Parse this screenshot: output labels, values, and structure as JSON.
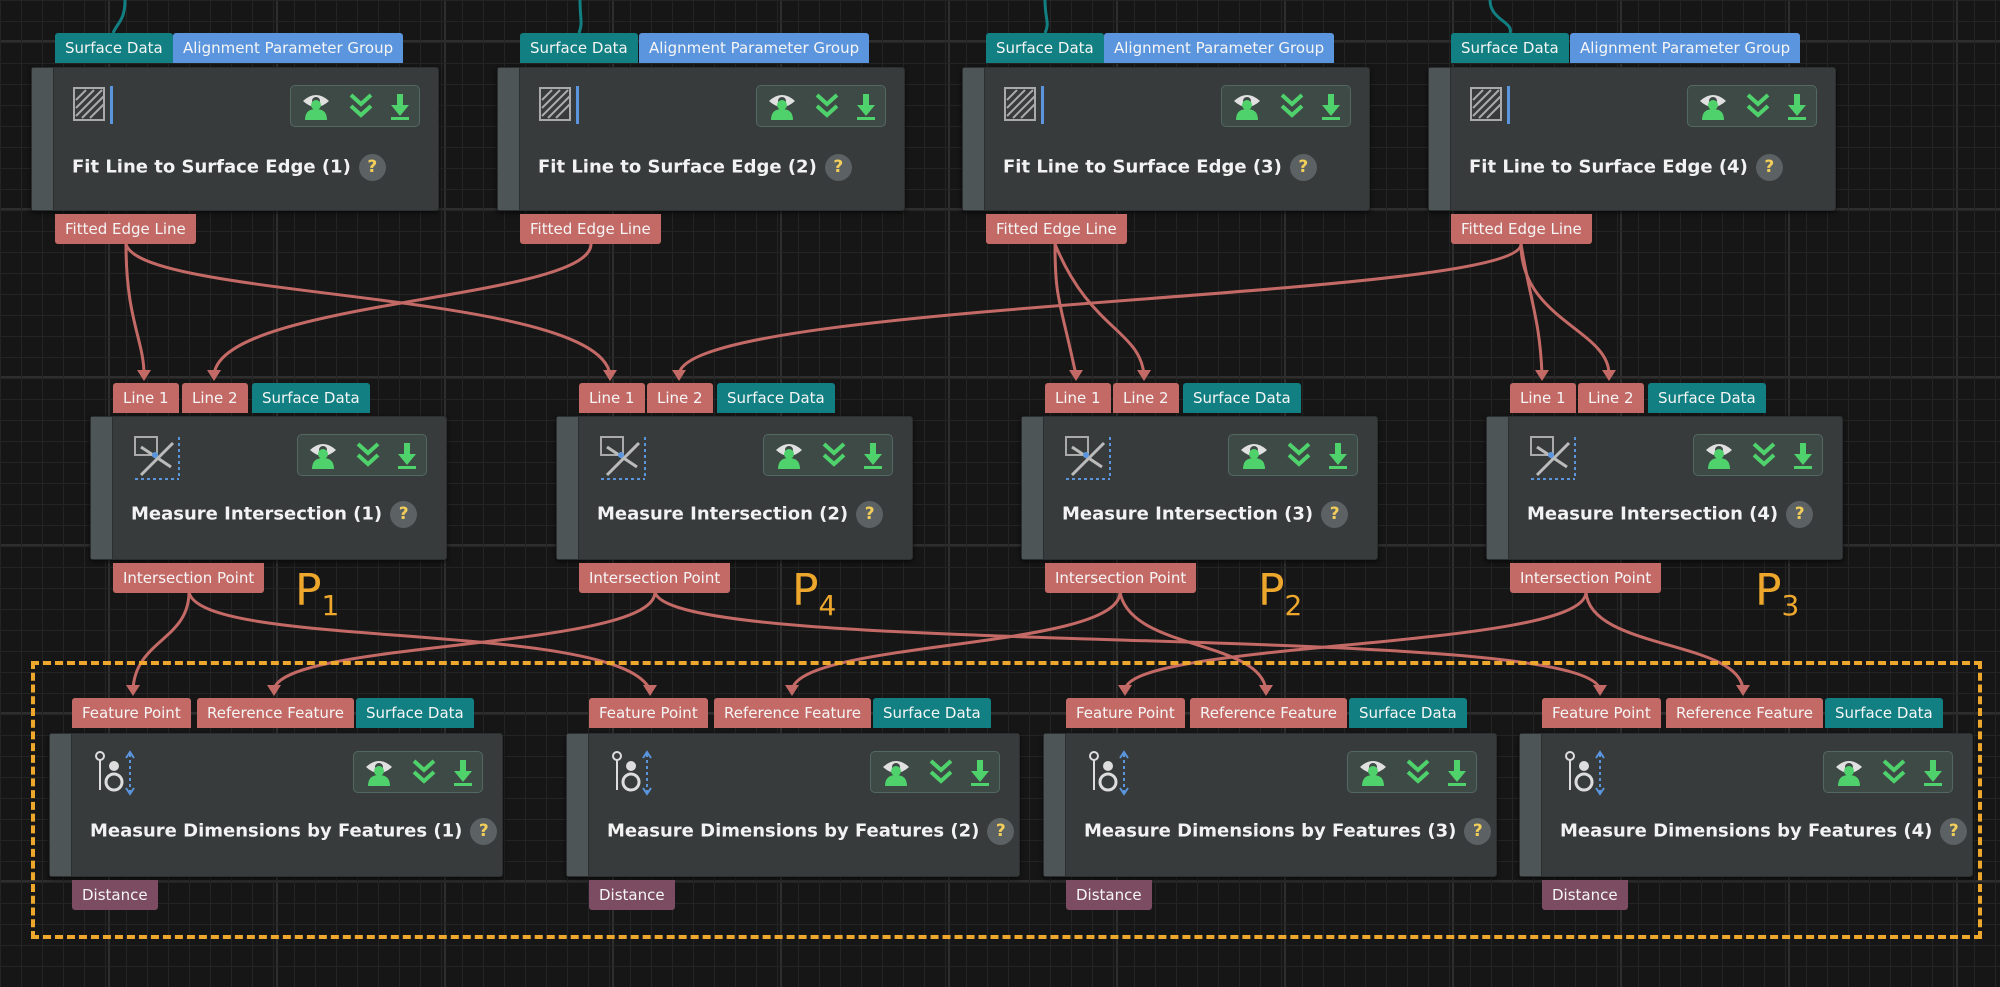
{
  "fit_nodes": [
    {
      "title": "Fit Line to Surface Edge (1)",
      "inputs": [
        "Surface Data",
        "Alignment Parameter Group"
      ],
      "output": "Fitted Edge Line"
    },
    {
      "title": "Fit Line to Surface Edge (2)",
      "inputs": [
        "Surface Data",
        "Alignment Parameter Group"
      ],
      "output": "Fitted Edge Line"
    },
    {
      "title": "Fit Line to Surface Edge (3)",
      "inputs": [
        "Surface Data",
        "Alignment Parameter Group"
      ],
      "output": "Fitted Edge Line"
    },
    {
      "title": "Fit Line to Surface Edge (4)",
      "inputs": [
        "Surface Data",
        "Alignment Parameter Group"
      ],
      "output": "Fitted Edge Line"
    }
  ],
  "intersect_nodes": [
    {
      "title": "Measure Intersection (1)",
      "inputs": [
        "Line 1",
        "Line 2",
        "Surface Data"
      ],
      "output": "Intersection Point"
    },
    {
      "title": "Measure Intersection (2)",
      "inputs": [
        "Line 1",
        "Line 2",
        "Surface Data"
      ],
      "output": "Intersection Point"
    },
    {
      "title": "Measure Intersection (3)",
      "inputs": [
        "Line 1",
        "Line 2",
        "Surface Data"
      ],
      "output": "Intersection Point"
    },
    {
      "title": "Measure Intersection (4)",
      "inputs": [
        "Line 1",
        "Line 2",
        "Surface Data"
      ],
      "output": "Intersection Point"
    }
  ],
  "dimension_nodes": [
    {
      "title": "Measure Dimensions by Features (1)",
      "inputs": [
        "Feature Point",
        "Reference Feature",
        "Surface Data"
      ],
      "output": "Distance"
    },
    {
      "title": "Measure Dimensions by Features (2)",
      "inputs": [
        "Feature Point",
        "Reference Feature",
        "Surface Data"
      ],
      "output": "Distance"
    },
    {
      "title": "Measure Dimensions by Features (3)",
      "inputs": [
        "Feature Point",
        "Reference Feature",
        "Surface Data"
      ],
      "output": "Distance"
    },
    {
      "title": "Measure Dimensions by Features (4)",
      "inputs": [
        "Feature Point",
        "Reference Feature",
        "Surface Data"
      ],
      "output": "Distance"
    }
  ],
  "point_labels": [
    {
      "letter": "P",
      "index": "1"
    },
    {
      "letter": "P",
      "index": "4"
    },
    {
      "letter": "P",
      "index": "2"
    },
    {
      "letter": "P",
      "index": "3"
    }
  ],
  "help_glyph": "?",
  "node_toolbar_icons": [
    "visibility-icon",
    "collapse-icon",
    "output-download-icon"
  ],
  "colors": {
    "surface_port": "#127f82",
    "parameter_port": "#5b95de",
    "line_port": "#c46a66",
    "distance_port": "#7c4c63",
    "wire": "#c46a66",
    "highlight_box": "#eda72c"
  }
}
